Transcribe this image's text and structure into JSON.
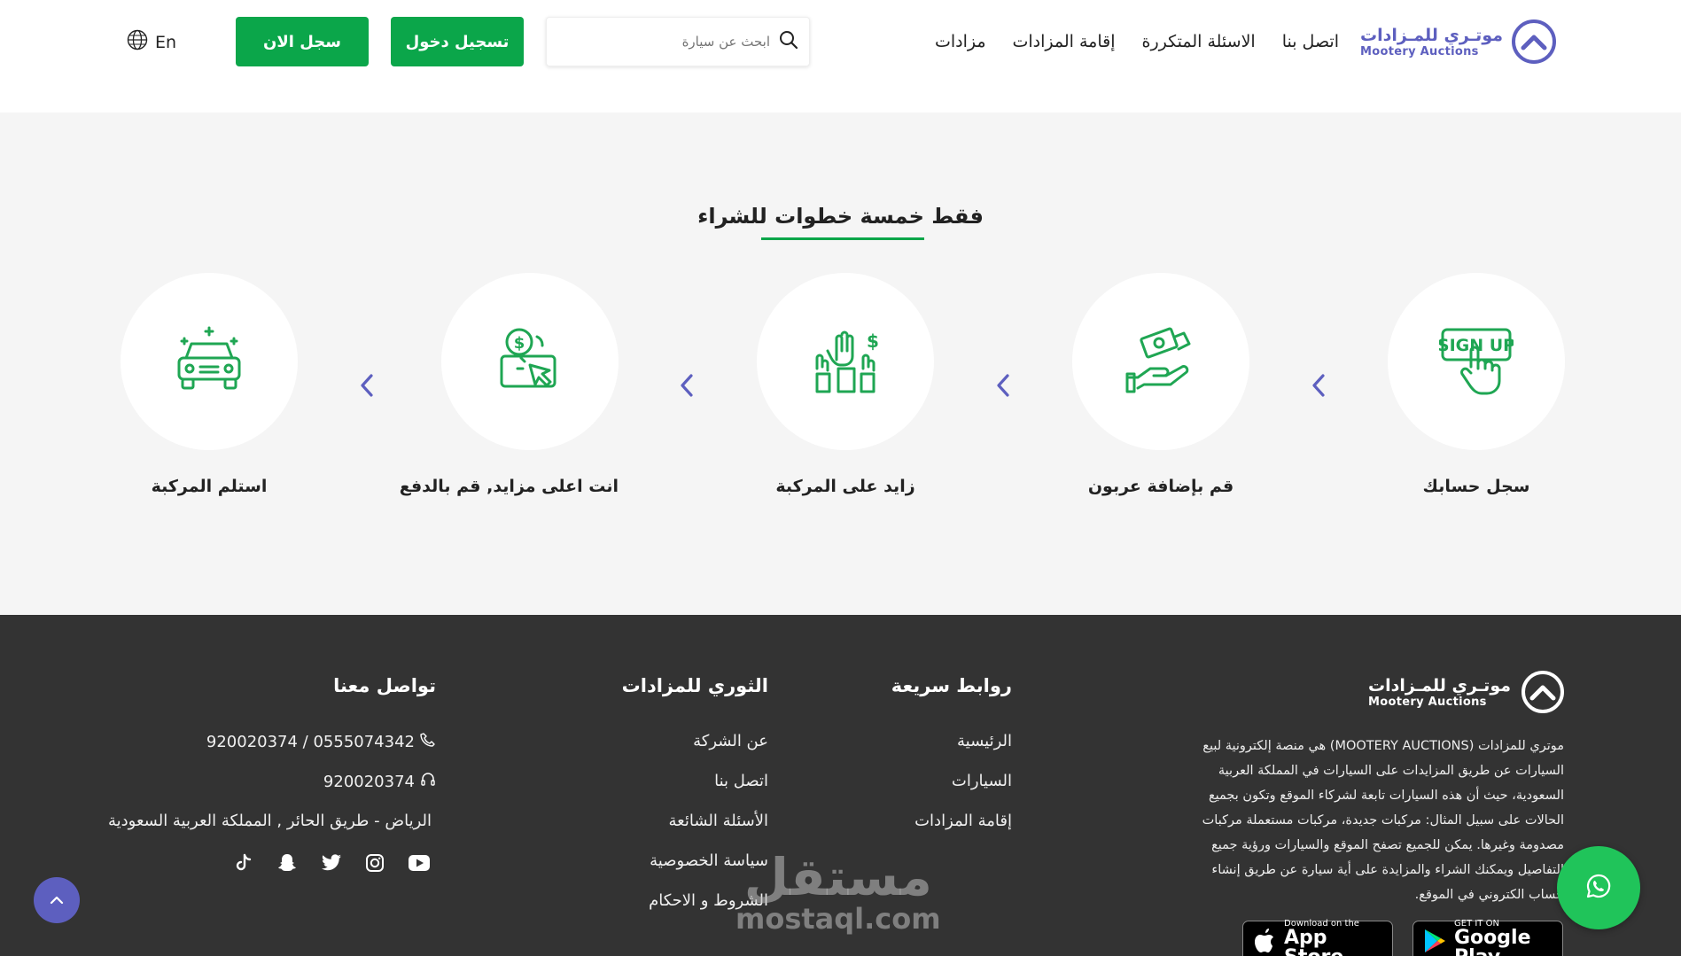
{
  "header": {
    "logo_ar": "موتـري للمـزادات",
    "logo_en": "Mootery Auctions",
    "nav": [
      "مزادات",
      "إقامة المزادات",
      "الاسئلة المتكررة",
      "اتصل بنا"
    ],
    "search_placeholder": "ابحث عن سيارة",
    "login_label": "تسجيل دخول",
    "signup_label": "سجل الان",
    "lang_label": "En"
  },
  "steps": {
    "title": "فقط خمسة خطوات للشراء",
    "items": [
      {
        "label": "سجل حسابك",
        "icon": "signup-hand-icon"
      },
      {
        "label": "قم بإضافة عربون",
        "icon": "money-hand-icon"
      },
      {
        "label": "زايد على المركبة",
        "icon": "raised-hands-bid-icon"
      },
      {
        "label": "انت اعلى مزايد, قم بالدفع",
        "icon": "pay-click-icon"
      },
      {
        "label": "استلم المركبة",
        "icon": "car-icon"
      }
    ]
  },
  "footer": {
    "logo_ar": "موتـري للمـزادات",
    "logo_en": "Mootery Auctions",
    "about": "موتري للمزادات (MOOTERY AUCTIONS) هي منصة إلكترونية لبيع السيارات عن طريق المزايدات على السيارات في المملكة العربية السعودية، حيث أن هذه السيارات تابعة لشركاء الموقع وتكون بجميع الحالات على سبيل المثال: مركبات جديدة، مركبات مستعملة مركبات مصدومة وغيرها. يمكن للجميع تصفح الموقع والسيارات ورؤية جميع التفاصيل ويمكنك الشراء والمزايدة على أية سيارة عن طريق إنشاء حساب الكتروني في الموقع.",
    "quick_links": {
      "title": "روابط سريعة",
      "items": [
        "الرئيسية",
        "السيارات",
        "إقامة المزادات"
      ]
    },
    "mootery": {
      "title": "الثوري للمزادات",
      "items": [
        "عن الشركة",
        "اتصل بنا",
        "الأسئلة الشائعة",
        "سياسة الخصوصية",
        "الشروط و الاحكام"
      ]
    },
    "contact": {
      "title": "تواصل معنا",
      "phones": "920020374 / 0555074342",
      "support": "920020374",
      "address": "الرياض - طريق الحائر , المملكة العربية السعودية"
    },
    "socials": [
      "youtube-icon",
      "instagram-icon",
      "twitter-icon",
      "snapchat-icon",
      "tiktok-icon"
    ],
    "app_store": {
      "small": "Download on the",
      "big": "App Store"
    },
    "google_play": {
      "small": "GET IT ON",
      "big": "Google Play"
    }
  },
  "watermark": {
    "ar": "مستقل",
    "en": "mostaql.com"
  },
  "colors": {
    "green": "#0ba64a",
    "purple": "#5d5fbf",
    "footer": "#333333",
    "whatsapp": "#20c45a"
  }
}
